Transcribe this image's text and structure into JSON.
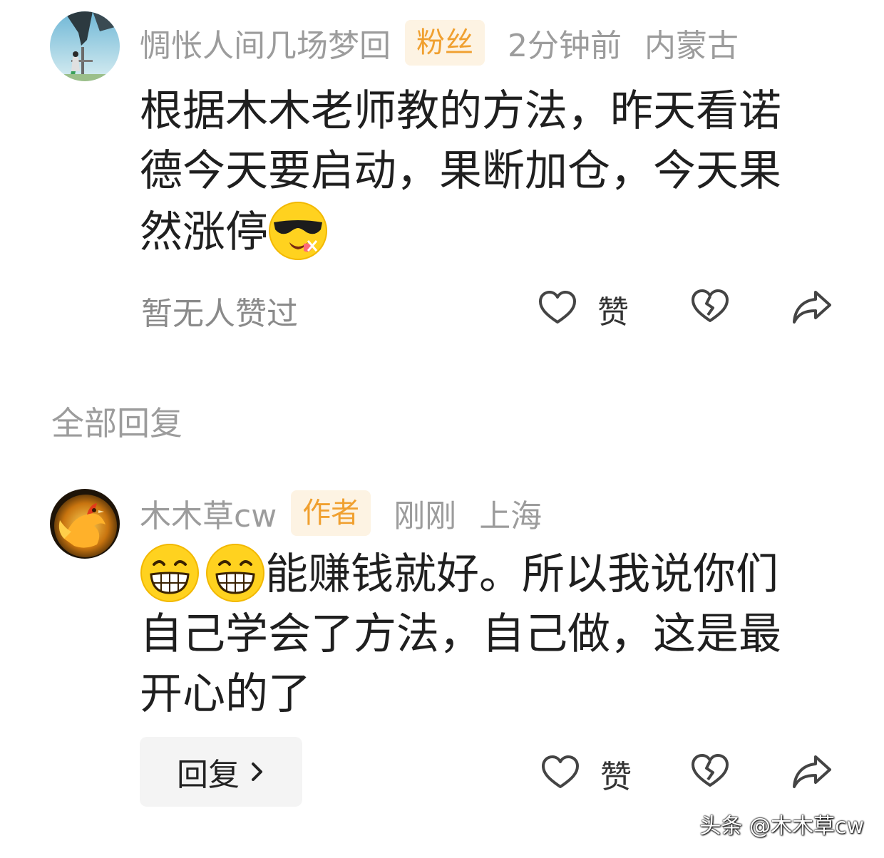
{
  "comment": {
    "username": "惆怅人间几场梦回",
    "badge": "粉丝",
    "time": "2分钟前",
    "location": "内蒙古",
    "text_line1": "根据木木老师教的方法，昨天看诺",
    "text_line2": "德今天要启动，果断加仓，今天果",
    "text_line3": "然涨停",
    "emoji": "sunglasses-emoji",
    "likes_status": "暂无人赞过",
    "like_label": "赞"
  },
  "replies_header": "全部回复",
  "reply": {
    "username": "木木草cw",
    "badge": "作者",
    "time": "刚刚",
    "location": "上海",
    "emoji": "grinning-emoji",
    "text_line1": "能赚钱就好。所以我说你们",
    "text_line2": "自己学会了方法，自己做，这是最",
    "text_line3": "开心的了",
    "reply_button_label": "回复",
    "like_label": "赞"
  },
  "watermark": "头条 @木木草cw",
  "colors": {
    "badge_bg": "#fdf3e3",
    "badge_text": "#f0a030",
    "muted_text": "#9c9c9c"
  }
}
